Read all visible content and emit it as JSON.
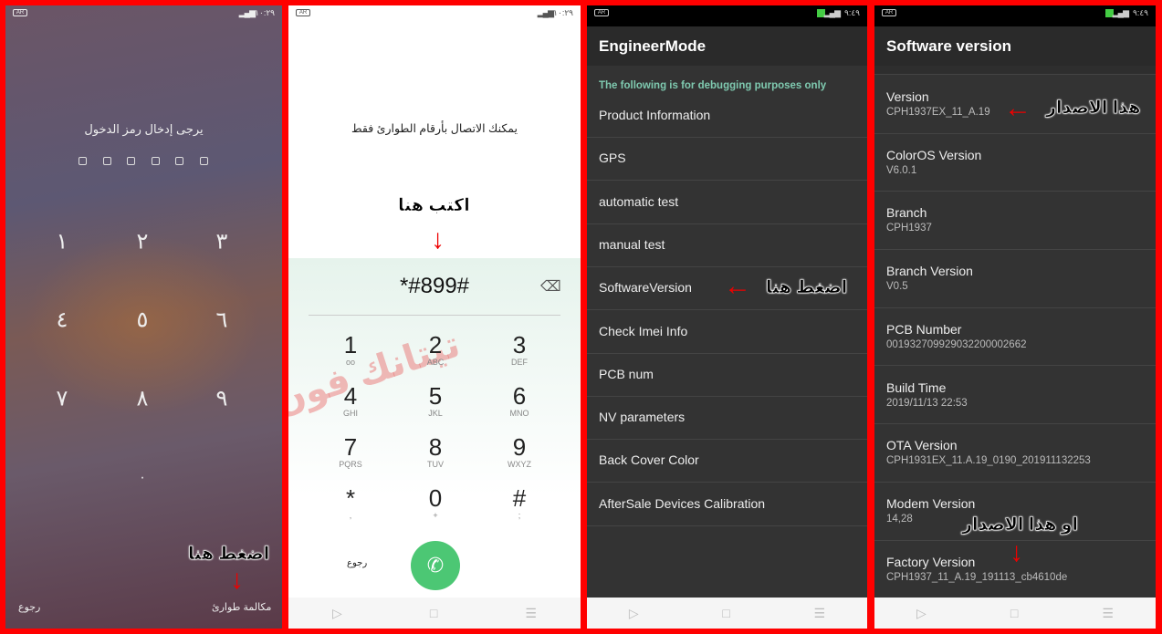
{
  "lock_screen": {
    "status_time": "١٠:٢٩",
    "battery": "AR",
    "prompt": "يرجى إدخال رمز الدخول",
    "pin_slots": 6,
    "keys": [
      "١",
      "٢",
      "٣",
      "٤",
      "٥",
      "٦",
      "٧",
      "٨",
      "٩",
      "٠"
    ],
    "back": "رجوع",
    "emergency_call": "مكالمة طوارئ",
    "annotation": "اضغط هنا"
  },
  "dialer": {
    "status_time": "١٠:٢٩",
    "battery": "AR",
    "notice": "يمكنك الاتصال بأرقام الطوارئ فقط",
    "annotation": "اكتب هنا",
    "input_value": "*#899#",
    "keys": [
      {
        "d": "1",
        "l": "oo"
      },
      {
        "d": "2",
        "l": "ABC"
      },
      {
        "d": "3",
        "l": "DEF"
      },
      {
        "d": "4",
        "l": "GHI"
      },
      {
        "d": "5",
        "l": "JKL"
      },
      {
        "d": "6",
        "l": "MNO"
      },
      {
        "d": "7",
        "l": "PQRS"
      },
      {
        "d": "8",
        "l": "TUV"
      },
      {
        "d": "9",
        "l": "WXYZ"
      },
      {
        "d": "*",
        "l": ","
      },
      {
        "d": "0",
        "l": "+"
      },
      {
        "d": "#",
        "l": ";"
      }
    ],
    "back": "رجوع",
    "call_color": "#4cc774",
    "watermark": "تيتانك فون لخدمات الهاتف المحمول"
  },
  "engineer_mode": {
    "status_time": "٩:٤٩",
    "battery": "AR",
    "title": "EngineerMode",
    "subtitle": "The following is for debugging purposes only",
    "subtitle_color": "#7fcab0",
    "items": [
      "Product Information",
      "GPS",
      "automatic test",
      "manual test",
      "SoftwareVersion",
      "Check Imei Info",
      "PCB num",
      "NV parameters",
      "Back Cover Color",
      "AfterSale Devices Calibration"
    ],
    "annotation": "اضغط هنا"
  },
  "software_version": {
    "status_time": "٩:٤٩",
    "battery": "AR",
    "title": "Software version",
    "items": [
      {
        "t": "Version",
        "v": "CPH1937EX_11_A.19"
      },
      {
        "t": "ColorOS Version",
        "v": "V6.0.1"
      },
      {
        "t": "Branch",
        "v": "CPH1937"
      },
      {
        "t": "Branch Version",
        "v": "V0.5"
      },
      {
        "t": "PCB Number",
        "v": "001932709929032200002662"
      },
      {
        "t": "Build Time",
        "v": "2019/11/13 22:53"
      },
      {
        "t": "OTA Version",
        "v": "CPH1931EX_11.A.19_0190_201911132253"
      },
      {
        "t": "Modem Version",
        "v": "14,28"
      },
      {
        "t": "Factory Version",
        "v": "CPH1937_11_A.19_191113_cb4610de"
      }
    ],
    "annotation_1": "هذا الاصدار",
    "annotation_2": "او هذا الاصدار"
  },
  "nav_icons": [
    "back-triangle-icon",
    "home-square-icon",
    "menu-lines-icon"
  ]
}
